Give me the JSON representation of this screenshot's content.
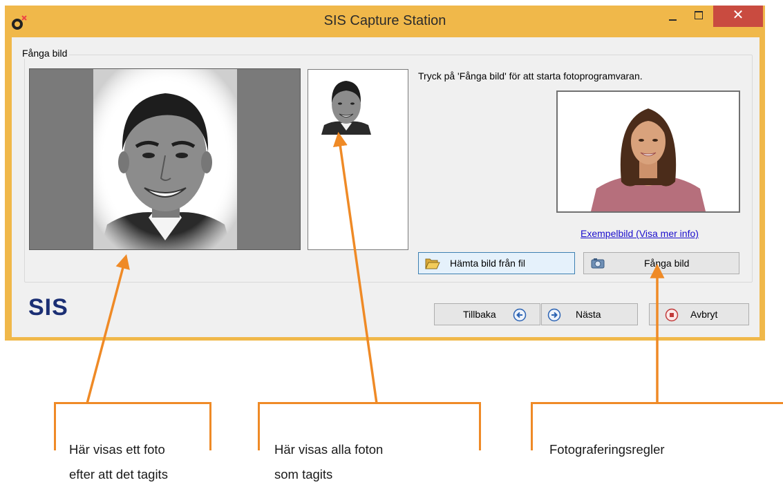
{
  "window": {
    "title": "SIS Capture Station",
    "close_glyph": "✕",
    "colors": {
      "titlebar": "#f0b84a",
      "close": "#c94b40",
      "client": "#f0f0f0"
    }
  },
  "group": {
    "legend": "Fånga bild",
    "instruction": "Tryck på 'Fånga bild' för att starta fotoprogramvaran.",
    "example_link": "Exempelbild (Visa mer info)",
    "buttons": {
      "file": "Hämta bild från fil",
      "capture": "Fånga bild"
    }
  },
  "footer": {
    "logo": "SIS",
    "buttons": {
      "back": "Tillbaka",
      "next": "Nästa",
      "cancel": "Avbryt"
    }
  },
  "callouts": [
    {
      "line1": "Här visas ett foto",
      "line2": "efter att det tagits"
    },
    {
      "line1": "Här visas alla foton",
      "line2": "som tagits"
    },
    {
      "line1": "Fotograferingsregler",
      "line2": ""
    }
  ],
  "accent": "#ef8a26",
  "icons": {
    "app": "app-logo-icon",
    "file": "folder-open-icon",
    "capture": "camera-icon",
    "back": "arrow-left-circle-icon",
    "next": "arrow-right-circle-icon",
    "cancel": "stop-circle-icon"
  }
}
